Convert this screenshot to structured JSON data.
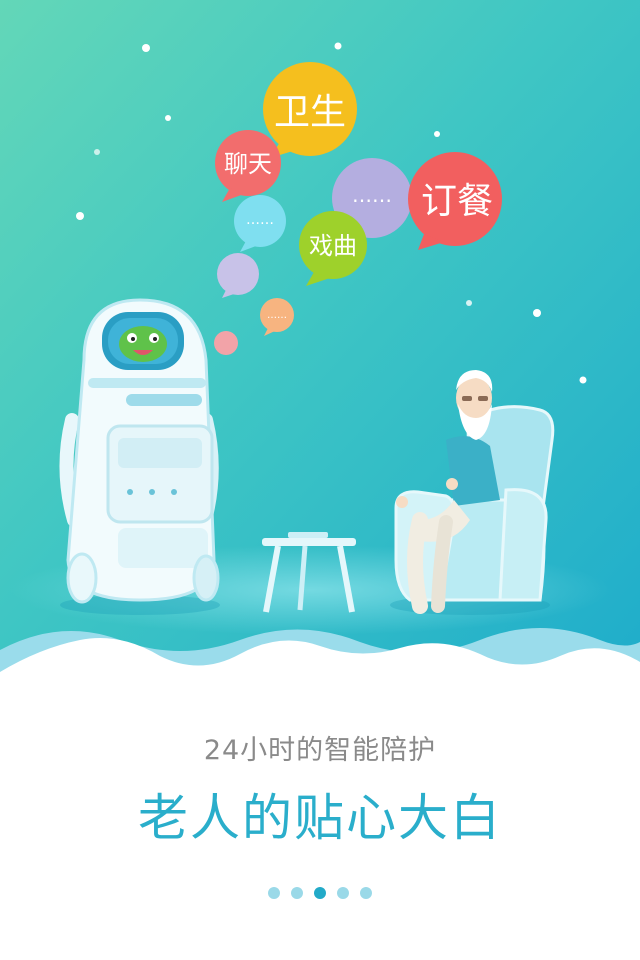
{
  "bubbles": {
    "health": "卫生",
    "chat": "聊天",
    "dots_a": "……",
    "opera": "戏曲",
    "dots_b": "……",
    "order": "订餐",
    "dots_c": "……"
  },
  "caption": {
    "subtitle": "24小时的智能陪护",
    "title": "老人的贴心大白"
  },
  "pager": {
    "count": 5,
    "active_index": 2
  },
  "colors": {
    "bg_top": "#5ed4bb",
    "bg_bottom": "#22aecb",
    "bubble_yellow": "#f5bf1e",
    "bubble_red": "#f26d6d",
    "bubble_lavender": "#b4aee0",
    "bubble_cyan": "#7fdff0",
    "bubble_green": "#9ed12b",
    "bubble_orange": "#f7b480",
    "bubble_pink": "#f2a3a8",
    "title_blue": "#2aaecb",
    "subtitle_gray": "#8a8a8a"
  }
}
